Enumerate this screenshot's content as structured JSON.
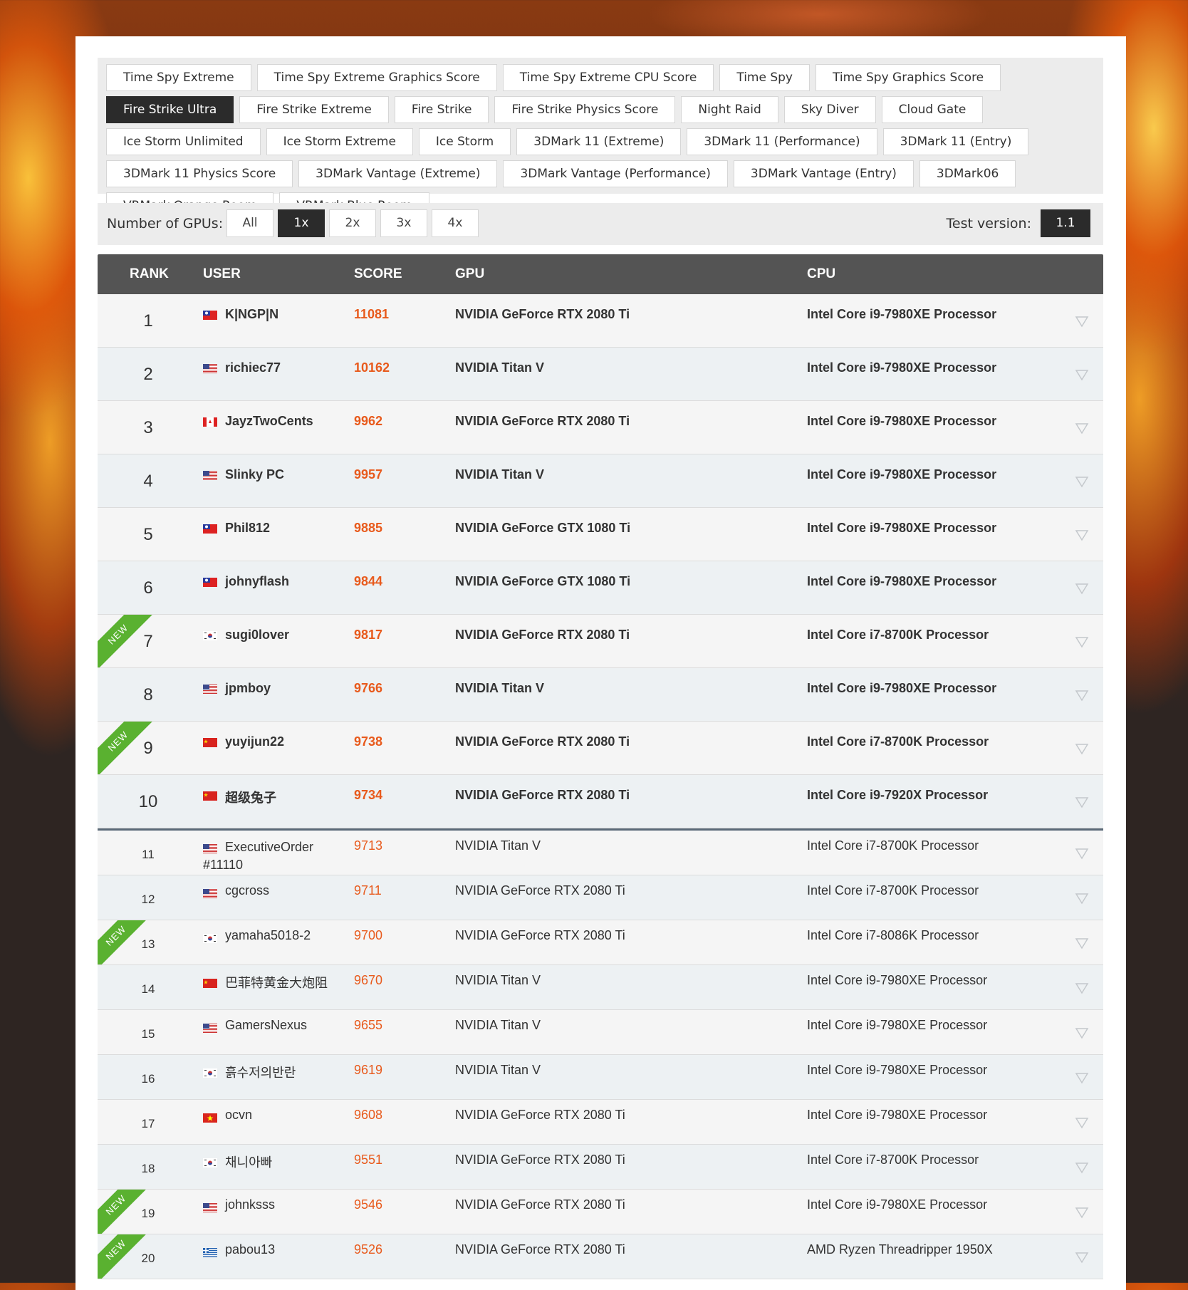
{
  "tests": [
    {
      "label": "Time Spy Extreme",
      "active": false
    },
    {
      "label": "Time Spy Extreme Graphics Score",
      "active": false
    },
    {
      "label": "Time Spy Extreme CPU Score",
      "active": false
    },
    {
      "label": "Time Spy",
      "active": false
    },
    {
      "label": "Time Spy Graphics Score",
      "active": false
    },
    {
      "label": "Fire Strike Ultra",
      "active": true
    },
    {
      "label": "Fire Strike Extreme",
      "active": false
    },
    {
      "label": "Fire Strike",
      "active": false
    },
    {
      "label": "Fire Strike Physics Score",
      "active": false
    },
    {
      "label": "Night Raid",
      "active": false
    },
    {
      "label": "Sky Diver",
      "active": false
    },
    {
      "label": "Cloud Gate",
      "active": false
    },
    {
      "label": "Ice Storm Unlimited",
      "active": false
    },
    {
      "label": "Ice Storm Extreme",
      "active": false
    },
    {
      "label": "Ice Storm",
      "active": false
    },
    {
      "label": "3DMark 11 (Extreme)",
      "active": false
    },
    {
      "label": "3DMark 11 (Performance)",
      "active": false
    },
    {
      "label": "3DMark 11 (Entry)",
      "active": false
    },
    {
      "label": "3DMark 11 Physics Score",
      "active": false
    },
    {
      "label": "3DMark Vantage (Extreme)",
      "active": false
    },
    {
      "label": "3DMark Vantage (Performance)",
      "active": false
    },
    {
      "label": "3DMark Vantage (Entry)",
      "active": false
    },
    {
      "label": "3DMark06",
      "active": false
    },
    {
      "label": "VRMark Orange Room",
      "active": false
    },
    {
      "label": "VRMark Blue Room",
      "active": false
    }
  ],
  "gpu_filter": {
    "label": "Number of GPUs:",
    "options": [
      {
        "label": "All",
        "active": false
      },
      {
        "label": "1x",
        "active": true
      },
      {
        "label": "2x",
        "active": false
      },
      {
        "label": "3x",
        "active": false
      },
      {
        "label": "4x",
        "active": false
      }
    ],
    "version_label": "Test version:",
    "version_value": "1.1"
  },
  "table": {
    "headers": {
      "rank": "RANK",
      "user": "USER",
      "score": "SCORE",
      "gpu": "GPU",
      "cpu": "CPU"
    },
    "new_badge": "NEW",
    "rows": [
      {
        "rank": "1",
        "flag": "tw",
        "user": "K|NGP|N",
        "score": "11081",
        "gpu": "NVIDIA GeForce RTX 2080 Ti",
        "cpu": "Intel Core i9-7980XE Processor",
        "new": false
      },
      {
        "rank": "2",
        "flag": "us",
        "user": "richiec77",
        "score": "10162",
        "gpu": "NVIDIA Titan V",
        "cpu": "Intel Core i9-7980XE Processor",
        "new": false
      },
      {
        "rank": "3",
        "flag": "ca",
        "user": "JayzTwoCents",
        "score": "9962",
        "gpu": "NVIDIA GeForce RTX 2080 Ti",
        "cpu": "Intel Core i9-7980XE Processor",
        "new": false
      },
      {
        "rank": "4",
        "flag": "us",
        "user": "Slinky PC",
        "score": "9957",
        "gpu": "NVIDIA Titan V",
        "cpu": "Intel Core i9-7980XE Processor",
        "new": false
      },
      {
        "rank": "5",
        "flag": "tw",
        "user": "Phil812",
        "score": "9885",
        "gpu": "NVIDIA GeForce GTX 1080 Ti",
        "cpu": "Intel Core i9-7980XE Processor",
        "new": false
      },
      {
        "rank": "6",
        "flag": "tw",
        "user": "johnyflash",
        "score": "9844",
        "gpu": "NVIDIA GeForce GTX 1080 Ti",
        "cpu": "Intel Core i9-7980XE Processor",
        "new": false
      },
      {
        "rank": "7",
        "flag": "kr",
        "user": "sugi0lover",
        "score": "9817",
        "gpu": "NVIDIA GeForce RTX 2080 Ti",
        "cpu": "Intel Core i7-8700K Processor",
        "new": true
      },
      {
        "rank": "8",
        "flag": "us",
        "user": "jpmboy",
        "score": "9766",
        "gpu": "NVIDIA Titan V",
        "cpu": "Intel Core i9-7980XE Processor",
        "new": false
      },
      {
        "rank": "9",
        "flag": "cn",
        "user": "yuyijun22",
        "score": "9738",
        "gpu": "NVIDIA GeForce RTX 2080 Ti",
        "cpu": "Intel Core i7-8700K Processor",
        "new": true
      },
      {
        "rank": "10",
        "flag": "cn",
        "user": "超级兔子",
        "score": "9734",
        "gpu": "NVIDIA GeForce RTX 2080 Ti",
        "cpu": "Intel Core i9-7920X Processor",
        "new": false
      },
      {
        "rank": "11",
        "flag": "us",
        "user": "ExecutiveOrder #11110",
        "score": "9713",
        "gpu": "NVIDIA Titan V",
        "cpu": "Intel Core i7-8700K Processor",
        "new": false
      },
      {
        "rank": "12",
        "flag": "us",
        "user": "cgcross",
        "score": "9711",
        "gpu": "NVIDIA GeForce RTX 2080 Ti",
        "cpu": "Intel Core i7-8700K Processor",
        "new": false
      },
      {
        "rank": "13",
        "flag": "kr",
        "user": "yamaha5018-2",
        "score": "9700",
        "gpu": "NVIDIA GeForce RTX 2080 Ti",
        "cpu": "Intel Core i7-8086K Processor",
        "new": true
      },
      {
        "rank": "14",
        "flag": "cn",
        "user": "巴菲特黄金大炮阻",
        "score": "9670",
        "gpu": "NVIDIA Titan V",
        "cpu": "Intel Core i9-7980XE Processor",
        "new": false
      },
      {
        "rank": "15",
        "flag": "us",
        "user": "GamersNexus",
        "score": "9655",
        "gpu": "NVIDIA Titan V",
        "cpu": "Intel Core i9-7980XE Processor",
        "new": false
      },
      {
        "rank": "16",
        "flag": "kr",
        "user": "흙수저의반란",
        "score": "9619",
        "gpu": "NVIDIA Titan V",
        "cpu": "Intel Core i9-7980XE Processor",
        "new": false
      },
      {
        "rank": "17",
        "flag": "vn",
        "user": "ocvn",
        "score": "9608",
        "gpu": "NVIDIA GeForce RTX 2080 Ti",
        "cpu": "Intel Core i9-7980XE Processor",
        "new": false
      },
      {
        "rank": "18",
        "flag": "kr",
        "user": "채니아빠",
        "score": "9551",
        "gpu": "NVIDIA GeForce RTX 2080 Ti",
        "cpu": "Intel Core i7-8700K Processor",
        "new": false
      },
      {
        "rank": "19",
        "flag": "us",
        "user": "johnksss",
        "score": "9546",
        "gpu": "NVIDIA GeForce RTX 2080 Ti",
        "cpu": "Intel Core i9-7980XE Processor",
        "new": true
      },
      {
        "rank": "20",
        "flag": "gr",
        "user": "pabou13",
        "score": "9526",
        "gpu": "NVIDIA GeForce RTX 2080 Ti",
        "cpu": "AMD Ryzen Threadripper 1950X",
        "new": true
      }
    ]
  },
  "colors": {
    "accent_score": "#e85a1c",
    "active_button": "#2b2b2b",
    "new_badge": "#5ab130",
    "header": "#545454"
  },
  "icons": {
    "row_toggle": "chevron-down-icon",
    "country": "flag-icon"
  }
}
